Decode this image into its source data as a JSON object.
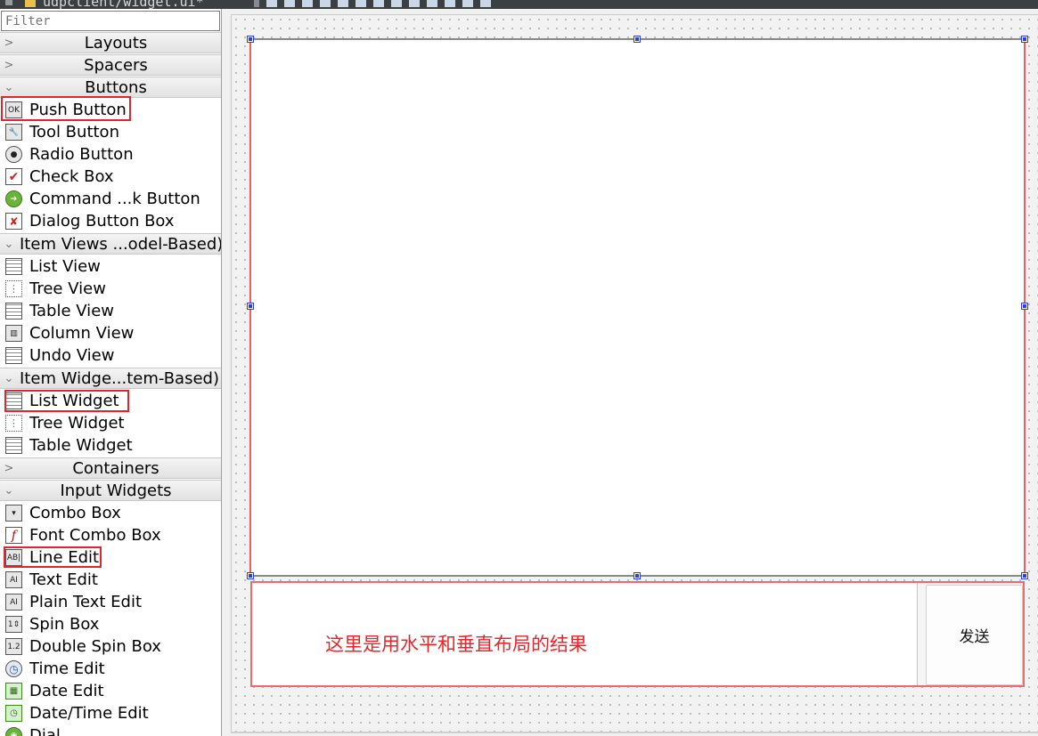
{
  "window": {
    "tab_title": "udpclient/widget.ui*"
  },
  "widget_box": {
    "filter_placeholder": "Filter",
    "categories": {
      "layouts": "Layouts",
      "spacers": "Spacers",
      "buttons": "Buttons",
      "item_views": "Item Views ...odel-Based)",
      "item_widgets": "Item Widge...tem-Based)",
      "containers": "Containers",
      "input_widgets": "Input Widgets"
    },
    "buttons": [
      {
        "label": "Push Button",
        "icon": "ok-button-icon",
        "glyph": "OK"
      },
      {
        "label": "Tool Button",
        "icon": "tool-button-icon",
        "glyph": "🔧"
      },
      {
        "label": "Radio Button",
        "icon": "radio-button-icon",
        "glyph": "●"
      },
      {
        "label": "Check Box",
        "icon": "check-box-icon",
        "glyph": "✔"
      },
      {
        "label": "Command ...k Button",
        "icon": "command-link-icon",
        "glyph": "➔"
      },
      {
        "label": "Dialog Button Box",
        "icon": "dialog-button-box-icon",
        "glyph": "✘"
      }
    ],
    "item_views": [
      {
        "label": "List View",
        "icon": "list-view-icon",
        "glyph": ""
      },
      {
        "label": "Tree View",
        "icon": "tree-view-icon",
        "glyph": "⋮"
      },
      {
        "label": "Table View",
        "icon": "table-view-icon",
        "glyph": ""
      },
      {
        "label": "Column View",
        "icon": "column-view-icon",
        "glyph": "▥"
      },
      {
        "label": "Undo View",
        "icon": "undo-view-icon",
        "glyph": ""
      }
    ],
    "item_widgets": [
      {
        "label": "List Widget",
        "icon": "list-widget-icon",
        "glyph": ""
      },
      {
        "label": "Tree Widget",
        "icon": "tree-widget-icon",
        "glyph": "⋮"
      },
      {
        "label": "Table Widget",
        "icon": "table-widget-icon",
        "glyph": ""
      }
    ],
    "input_widgets": [
      {
        "label": "Combo Box",
        "icon": "combo-box-icon",
        "glyph": "▾"
      },
      {
        "label": "Font Combo Box",
        "icon": "font-combo-box-icon",
        "glyph": "f"
      },
      {
        "label": "Line Edit",
        "icon": "line-edit-icon",
        "glyph": "AB|"
      },
      {
        "label": "Text Edit",
        "icon": "text-edit-icon",
        "glyph": "AI"
      },
      {
        "label": "Plain Text Edit",
        "icon": "plain-text-edit-icon",
        "glyph": "AI"
      },
      {
        "label": "Spin Box",
        "icon": "spin-box-icon",
        "glyph": "1⇕"
      },
      {
        "label": "Double Spin Box",
        "icon": "double-spin-box-icon",
        "glyph": "1.2"
      },
      {
        "label": "Time Edit",
        "icon": "time-edit-icon",
        "glyph": "◷"
      },
      {
        "label": "Date Edit",
        "icon": "date-edit-icon",
        "glyph": "▦"
      },
      {
        "label": "Date/Time Edit",
        "icon": "datetime-edit-icon",
        "glyph": "◷"
      },
      {
        "label": "Dial",
        "icon": "dial-icon",
        "glyph": "◉"
      }
    ]
  },
  "form": {
    "annotation": "这里是用水平和垂直布局的结果",
    "send_button": "发送"
  },
  "colors": {
    "highlight": "#e0262a",
    "selection_handle": "#2f3fd0"
  }
}
